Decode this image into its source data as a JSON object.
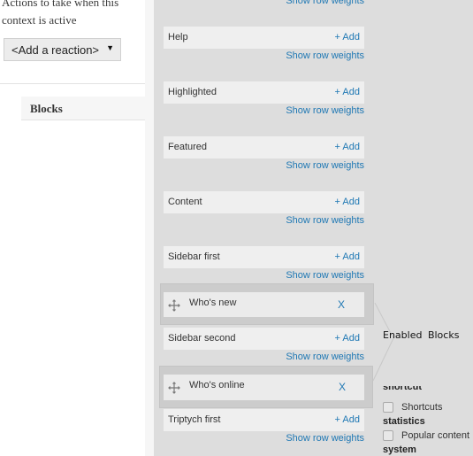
{
  "reactions": {
    "description": "Actions to take when this context is active",
    "select_value": "<Add a reaction>"
  },
  "tabs": {
    "blocks_label": "Blocks"
  },
  "top_partial": {
    "show_weights_label": "Show row weights"
  },
  "regions": [
    {
      "name": "Help",
      "add_label": "+ Add",
      "weights_label": "Show row weights"
    },
    {
      "name": "Highlighted",
      "add_label": "+ Add",
      "weights_label": "Show row weights"
    },
    {
      "name": "Featured",
      "add_label": "+ Add",
      "weights_label": "Show row weights"
    },
    {
      "name": "Content",
      "add_label": "+ Add",
      "weights_label": "Show row weights"
    },
    {
      "name": "Sidebar first",
      "add_label": "+ Add",
      "weights_label": "Show row weights"
    },
    {
      "name": "Sidebar second",
      "add_label": "+ Add",
      "weights_label": "Show row weights"
    },
    {
      "name": "Triptych first",
      "add_label": "+ Add",
      "weights_label": "Show row weights"
    }
  ],
  "blocks": [
    {
      "name": "Who's new",
      "remove_label": "X",
      "region": "Sidebar first"
    },
    {
      "name": "Who's online",
      "remove_label": "X",
      "region": "Sidebar second"
    }
  ],
  "enabled_blocks_label": "Enabled  Blocks",
  "available_blocks": {
    "categories": [
      {
        "name": "shortcut",
        "items": [
          {
            "label": "Shortcuts",
            "checked": false
          }
        ]
      },
      {
        "name": "statistics",
        "items": [
          {
            "label": "Popular content",
            "checked": false
          }
        ]
      },
      {
        "name": "system",
        "items": []
      }
    ]
  },
  "colors": {
    "link": "#1f78b4",
    "region_bg": "#dddddd",
    "header_bg": "#efefef",
    "block_box_bg": "#cccccc"
  }
}
